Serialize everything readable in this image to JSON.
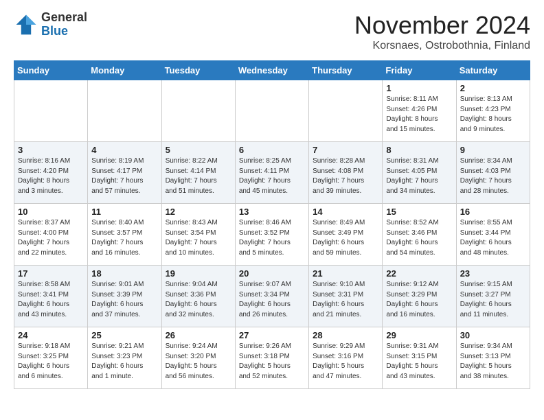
{
  "logo": {
    "general": "General",
    "blue": "Blue"
  },
  "header": {
    "month": "November 2024",
    "location": "Korsnaes, Ostrobothnia, Finland"
  },
  "weekdays": [
    "Sunday",
    "Monday",
    "Tuesday",
    "Wednesday",
    "Thursday",
    "Friday",
    "Saturday"
  ],
  "weeks": [
    [
      {
        "day": "",
        "info": ""
      },
      {
        "day": "",
        "info": ""
      },
      {
        "day": "",
        "info": ""
      },
      {
        "day": "",
        "info": ""
      },
      {
        "day": "",
        "info": ""
      },
      {
        "day": "1",
        "info": "Sunrise: 8:11 AM\nSunset: 4:26 PM\nDaylight: 8 hours\nand 15 minutes."
      },
      {
        "day": "2",
        "info": "Sunrise: 8:13 AM\nSunset: 4:23 PM\nDaylight: 8 hours\nand 9 minutes."
      }
    ],
    [
      {
        "day": "3",
        "info": "Sunrise: 8:16 AM\nSunset: 4:20 PM\nDaylight: 8 hours\nand 3 minutes."
      },
      {
        "day": "4",
        "info": "Sunrise: 8:19 AM\nSunset: 4:17 PM\nDaylight: 7 hours\nand 57 minutes."
      },
      {
        "day": "5",
        "info": "Sunrise: 8:22 AM\nSunset: 4:14 PM\nDaylight: 7 hours\nand 51 minutes."
      },
      {
        "day": "6",
        "info": "Sunrise: 8:25 AM\nSunset: 4:11 PM\nDaylight: 7 hours\nand 45 minutes."
      },
      {
        "day": "7",
        "info": "Sunrise: 8:28 AM\nSunset: 4:08 PM\nDaylight: 7 hours\nand 39 minutes."
      },
      {
        "day": "8",
        "info": "Sunrise: 8:31 AM\nSunset: 4:05 PM\nDaylight: 7 hours\nand 34 minutes."
      },
      {
        "day": "9",
        "info": "Sunrise: 8:34 AM\nSunset: 4:03 PM\nDaylight: 7 hours\nand 28 minutes."
      }
    ],
    [
      {
        "day": "10",
        "info": "Sunrise: 8:37 AM\nSunset: 4:00 PM\nDaylight: 7 hours\nand 22 minutes."
      },
      {
        "day": "11",
        "info": "Sunrise: 8:40 AM\nSunset: 3:57 PM\nDaylight: 7 hours\nand 16 minutes."
      },
      {
        "day": "12",
        "info": "Sunrise: 8:43 AM\nSunset: 3:54 PM\nDaylight: 7 hours\nand 10 minutes."
      },
      {
        "day": "13",
        "info": "Sunrise: 8:46 AM\nSunset: 3:52 PM\nDaylight: 7 hours\nand 5 minutes."
      },
      {
        "day": "14",
        "info": "Sunrise: 8:49 AM\nSunset: 3:49 PM\nDaylight: 6 hours\nand 59 minutes."
      },
      {
        "day": "15",
        "info": "Sunrise: 8:52 AM\nSunset: 3:46 PM\nDaylight: 6 hours\nand 54 minutes."
      },
      {
        "day": "16",
        "info": "Sunrise: 8:55 AM\nSunset: 3:44 PM\nDaylight: 6 hours\nand 48 minutes."
      }
    ],
    [
      {
        "day": "17",
        "info": "Sunrise: 8:58 AM\nSunset: 3:41 PM\nDaylight: 6 hours\nand 43 minutes."
      },
      {
        "day": "18",
        "info": "Sunrise: 9:01 AM\nSunset: 3:39 PM\nDaylight: 6 hours\nand 37 minutes."
      },
      {
        "day": "19",
        "info": "Sunrise: 9:04 AM\nSunset: 3:36 PM\nDaylight: 6 hours\nand 32 minutes."
      },
      {
        "day": "20",
        "info": "Sunrise: 9:07 AM\nSunset: 3:34 PM\nDaylight: 6 hours\nand 26 minutes."
      },
      {
        "day": "21",
        "info": "Sunrise: 9:10 AM\nSunset: 3:31 PM\nDaylight: 6 hours\nand 21 minutes."
      },
      {
        "day": "22",
        "info": "Sunrise: 9:12 AM\nSunset: 3:29 PM\nDaylight: 6 hours\nand 16 minutes."
      },
      {
        "day": "23",
        "info": "Sunrise: 9:15 AM\nSunset: 3:27 PM\nDaylight: 6 hours\nand 11 minutes."
      }
    ],
    [
      {
        "day": "24",
        "info": "Sunrise: 9:18 AM\nSunset: 3:25 PM\nDaylight: 6 hours\nand 6 minutes."
      },
      {
        "day": "25",
        "info": "Sunrise: 9:21 AM\nSunset: 3:23 PM\nDaylight: 6 hours\nand 1 minute."
      },
      {
        "day": "26",
        "info": "Sunrise: 9:24 AM\nSunset: 3:20 PM\nDaylight: 5 hours\nand 56 minutes."
      },
      {
        "day": "27",
        "info": "Sunrise: 9:26 AM\nSunset: 3:18 PM\nDaylight: 5 hours\nand 52 minutes."
      },
      {
        "day": "28",
        "info": "Sunrise: 9:29 AM\nSunset: 3:16 PM\nDaylight: 5 hours\nand 47 minutes."
      },
      {
        "day": "29",
        "info": "Sunrise: 9:31 AM\nSunset: 3:15 PM\nDaylight: 5 hours\nand 43 minutes."
      },
      {
        "day": "30",
        "info": "Sunrise: 9:34 AM\nSunset: 3:13 PM\nDaylight: 5 hours\nand 38 minutes."
      }
    ]
  ]
}
